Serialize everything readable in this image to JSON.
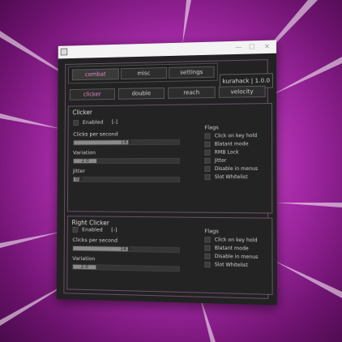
{
  "window": {
    "min_glyph": "—",
    "max_glyph": "☐",
    "close_glyph": "✕"
  },
  "tabs": [
    {
      "label": "combat",
      "active": true
    },
    {
      "label": "misc",
      "active": false
    },
    {
      "label": "settings",
      "active": false
    }
  ],
  "badge": "kurahack | 1.0.0",
  "subtabs": [
    {
      "label": "clicker",
      "active": true
    },
    {
      "label": "double",
      "active": false
    },
    {
      "label": "reach",
      "active": false
    },
    {
      "label": "velocity",
      "active": false
    }
  ],
  "clicker": {
    "title": "Clicker",
    "enabled_label": "Enabled",
    "keybind": "[-]",
    "cps_label": "Clicks per second",
    "cps_value": "14.0",
    "cps_fraction": 0.52,
    "variation_label": "Variation",
    "variation_value": "2.0",
    "variation_fraction": 0.22,
    "jitter_label": "Jitter",
    "jitter_value": "0.0",
    "jitter_fraction": 0.05,
    "flags_title": "Flags",
    "flags": [
      "Click on key hold",
      "Blatant mode",
      "RMB Lock",
      "Jitter",
      "Disable in menus",
      "Slot Whitelist"
    ]
  },
  "right_clicker": {
    "title": "Right Clicker",
    "enabled_label": "Enabled",
    "keybind": "[-]",
    "cps_label": "Clicks per second",
    "cps_value": "14.0",
    "cps_fraction": 0.52,
    "variation_label": "Variation",
    "variation_value": "2.0",
    "variation_fraction": 0.22,
    "flags_title": "Flags",
    "flags": [
      "Click on key hold",
      "Blatant mode",
      "Disable in menus",
      "Slot Whitelist"
    ]
  },
  "colors": {
    "accent": "#e888c4",
    "frame": "#6a4f6a",
    "window_bg": "#222222"
  }
}
